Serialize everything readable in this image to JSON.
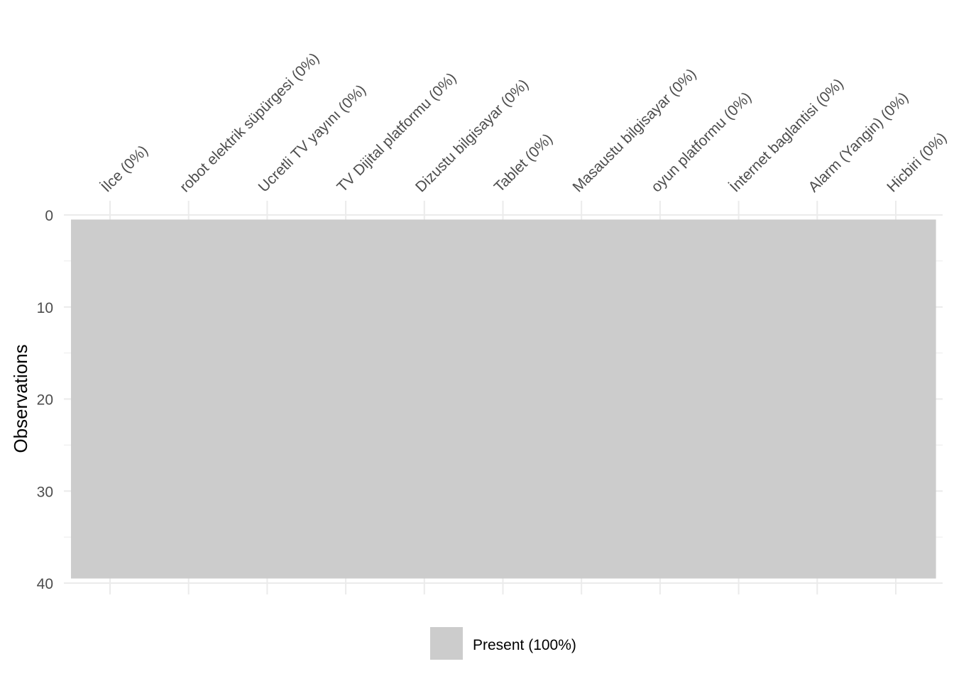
{
  "chart_data": {
    "type": "heatmap",
    "title": "",
    "xlabel": "",
    "ylabel": "Observations",
    "x_position": "top",
    "categories": [
      "İlce (0%)",
      "robot elektrik süpürgesi (0%)",
      "Ucretli TV yayını (0%)",
      "TV Dijital platformu (0%)",
      "Dizustu bilgisayar (0%)",
      "Tablet (0%)",
      "Masaustu bilgisayar (0%)",
      "oyun platformu (0%)",
      "İnternet baglantisi (0%)",
      "Alarm (Yangin) (0%)",
      "Hicbiri (0%)"
    ],
    "observations": 39,
    "ylim": [
      0,
      40
    ],
    "y_reversed": true,
    "y_ticks": [
      0,
      10,
      20,
      30,
      40
    ],
    "y_tick_labels": [
      "0",
      "10",
      "20",
      "30",
      "40"
    ],
    "cell_states": "all present",
    "grid": true,
    "legend_position": "bottom",
    "legend": [
      {
        "label": "Present (100%)",
        "color": "#cccccc"
      }
    ],
    "colors": {
      "present": "#cccccc",
      "grid": "#ebebeb",
      "tick_text": "#4d4d4d"
    }
  }
}
